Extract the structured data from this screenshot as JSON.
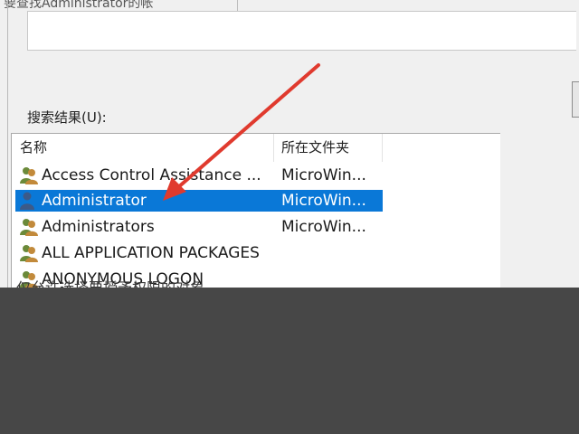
{
  "dialog": {
    "top_text": "要查找Administrator的帐",
    "results_label": "搜索结果(U):",
    "bottom_text": "仅允许选择要授予权限的对象"
  },
  "list": {
    "columns": [
      "名称",
      "所在文件夹"
    ],
    "rows": [
      {
        "name": "Access Control Assistance ...",
        "folder": "MicroWin...",
        "icon": "group-icon",
        "selected": false
      },
      {
        "name": "Administrator",
        "folder": "MicroWin...",
        "icon": "user-icon",
        "selected": true
      },
      {
        "name": "Administrators",
        "folder": "MicroWin...",
        "icon": "group-icon",
        "selected": false
      },
      {
        "name": "ALL APPLICATION PACKAGES",
        "folder": "",
        "icon": "group-icon",
        "selected": false
      },
      {
        "name": "ANONYMOUS LOGON",
        "folder": "",
        "icon": "group-icon",
        "selected": false
      }
    ]
  },
  "colors": {
    "selection": "#0a78d7",
    "arrow": "#e03a2e",
    "background": "#474747"
  }
}
